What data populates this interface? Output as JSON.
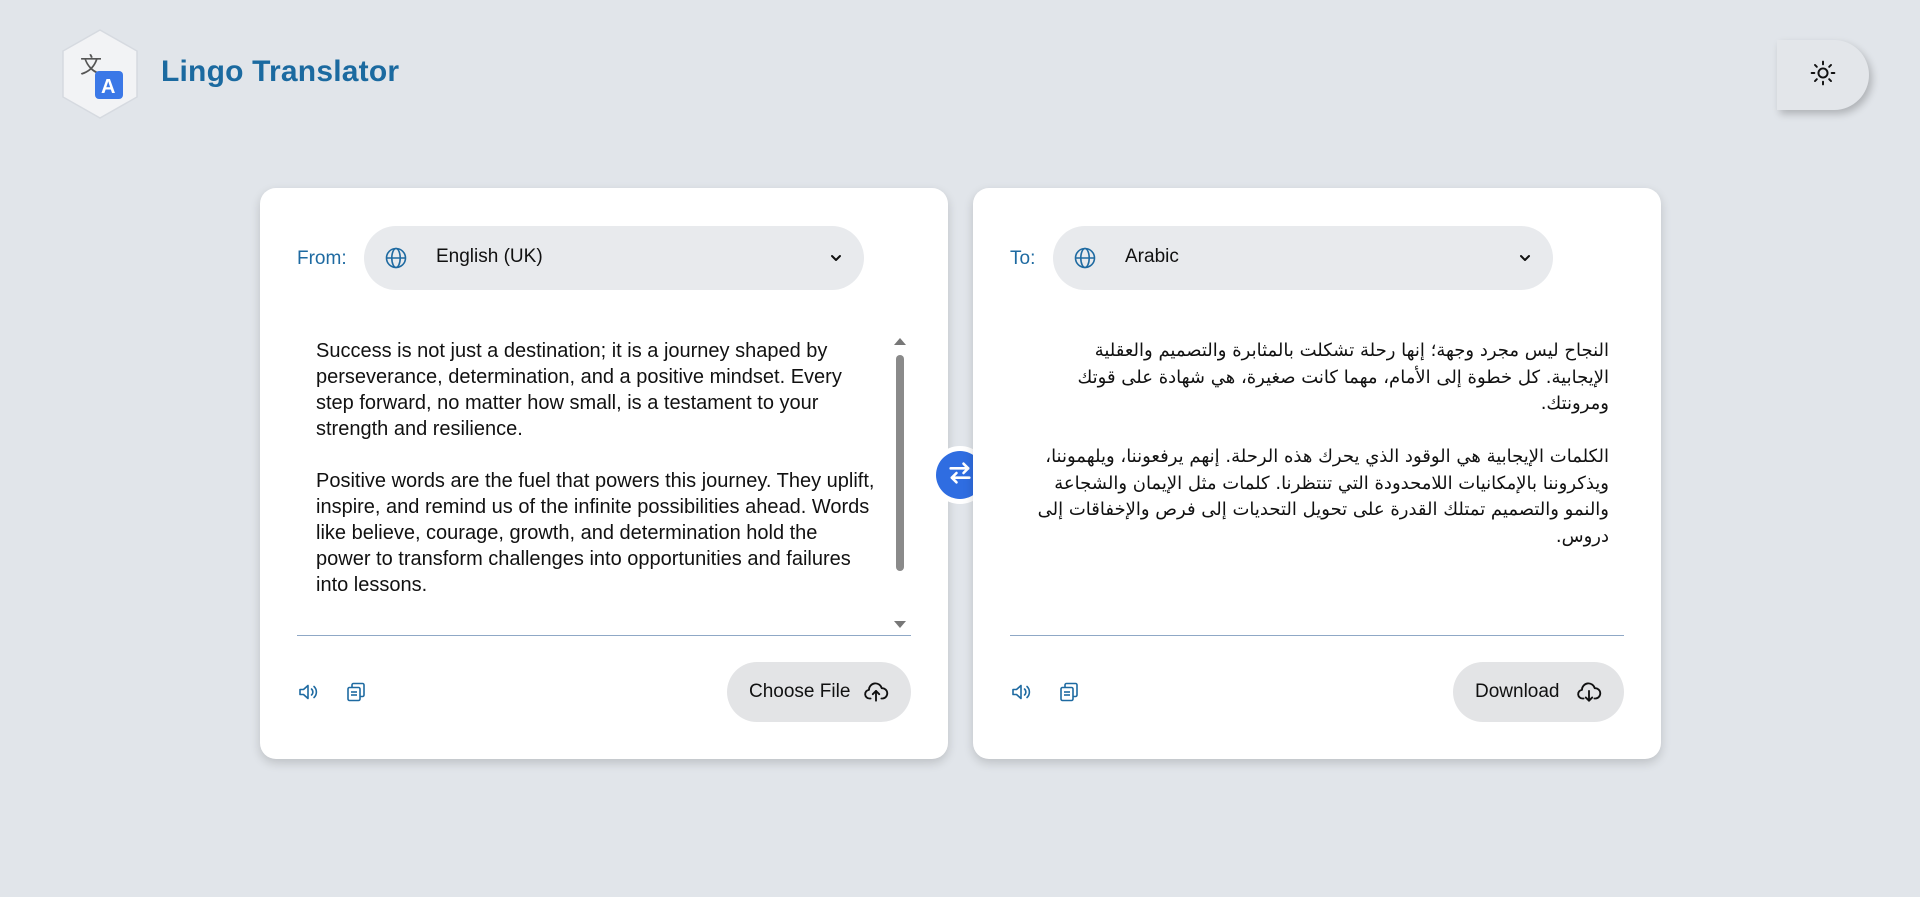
{
  "app": {
    "title": "Lingo Translator",
    "logo_glyphs": {
      "source": "文",
      "target": "A"
    }
  },
  "header": {
    "theme_toggle_icon": "sun-icon"
  },
  "source": {
    "label": "From:",
    "language": "English (UK)",
    "text": "Success is not just a destination; it is a journey shaped by perseverance, determination, and a positive mindset. Every step forward, no matter how small, is a testament to your strength and resilience.\n\nPositive words are the fuel that powers this journey. They uplift, inspire, and remind us of the infinite possibilities ahead. Words like believe, courage, growth, and determination hold the power to transform challenges into opportunities and failures into lessons.",
    "action_label": "Choose File",
    "action_icon": "cloud-upload-icon"
  },
  "target": {
    "label": "To:",
    "language": "Arabic",
    "text": "النجاح ليس مجرد وجهة؛ إنها رحلة تشكلت بالمثابرة والتصميم والعقلية الإيجابية. كل خطوة إلى الأمام، مهما كانت صغيرة، هي شهادة على قوتك ومرونتك.\n\nالكلمات الإيجابية هي الوقود الذي يحرك هذه الرحلة. إنهم يرفعوننا، ويلهموننا، ويذكروننا بالإمكانيات اللامحدودة التي تنتظرنا. كلمات مثل الإيمان والشجاعة والنمو والتصميم تمتلك القدرة على تحويل التحديات إلى فرص والإخفاقات إلى دروس.",
    "action_label": "Download",
    "action_icon": "cloud-download-icon"
  },
  "colors": {
    "background": "#e1e5ea",
    "brand": "#1b6aa0",
    "accent": "#2f6de1",
    "card": "#ffffff",
    "pill": "#e8eaed"
  }
}
